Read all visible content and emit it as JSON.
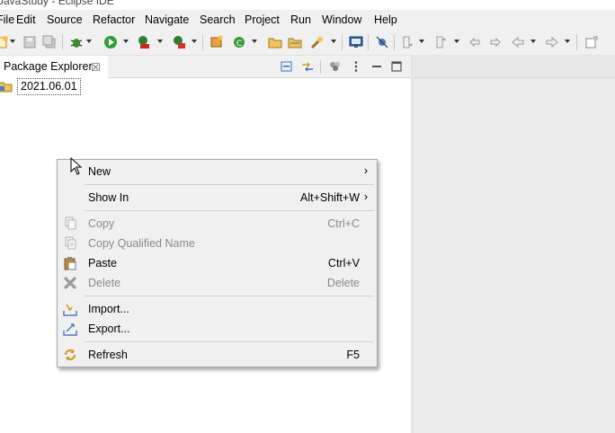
{
  "window": {
    "title": "JavaStudy - Eclipse IDE"
  },
  "menubar": {
    "items": [
      "File",
      "Edit",
      "Source",
      "Refactor",
      "Navigate",
      "Search",
      "Project",
      "Run",
      "Window",
      "Help"
    ]
  },
  "package_explorer": {
    "tab_label": "Package Explorer",
    "close_glyph": "☒",
    "project": "2021.06.01"
  },
  "context_menu": {
    "items": [
      {
        "label": "New",
        "shortcut": "",
        "submenu": "›",
        "enabled": true,
        "icon": "none"
      },
      {
        "label": "Show In",
        "shortcut": "Alt+Shift+W",
        "submenu": "›",
        "enabled": true,
        "icon": "none"
      },
      {
        "label": "Copy",
        "shortcut": "Ctrl+C",
        "submenu": "",
        "enabled": false,
        "icon": "copy-icon"
      },
      {
        "label": "Copy Qualified Name",
        "shortcut": "",
        "submenu": "",
        "enabled": false,
        "icon": "copy-qualified-name-icon"
      },
      {
        "label": "Paste",
        "shortcut": "Ctrl+V",
        "submenu": "",
        "enabled": true,
        "icon": "paste-icon"
      },
      {
        "label": "Delete",
        "shortcut": "Delete",
        "submenu": "",
        "enabled": false,
        "icon": "delete-icon"
      },
      {
        "label": "Import...",
        "shortcut": "",
        "submenu": "",
        "enabled": true,
        "icon": "import-icon"
      },
      {
        "label": "Export...",
        "shortcut": "",
        "submenu": "",
        "enabled": true,
        "icon": "export-icon"
      },
      {
        "label": "Refresh",
        "shortcut": "F5",
        "submenu": "",
        "enabled": true,
        "icon": "refresh-icon"
      }
    ]
  },
  "colors": {
    "menu_background": "#f0f0f0",
    "disabled_text": "#8a8a8a",
    "run_green": "#2e9e3a",
    "debug_green": "#3d8a2f"
  }
}
